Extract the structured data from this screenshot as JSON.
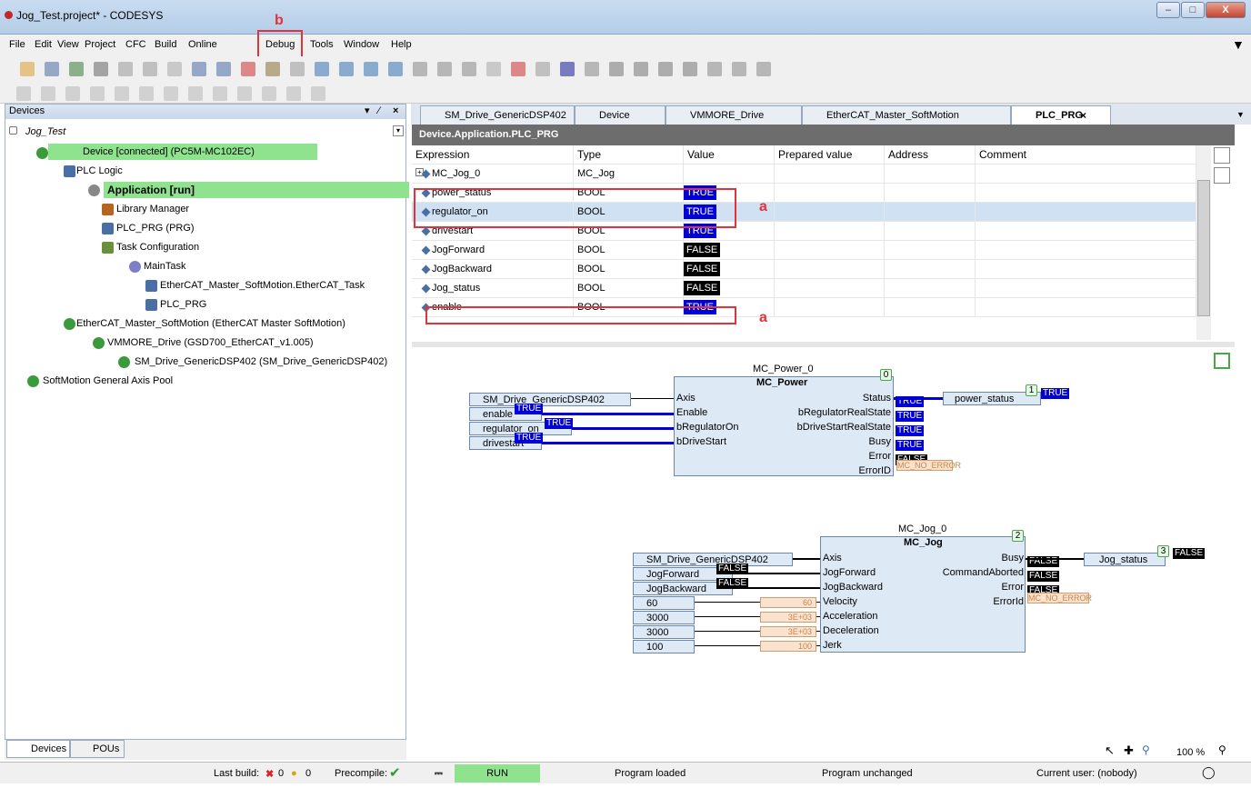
{
  "window": {
    "title": "Jog_Test.project* - CODESYS"
  },
  "menu": [
    "File",
    "Edit",
    "View",
    "Project",
    "CFC",
    "Build",
    "Online",
    "Debug",
    "Tools",
    "Window",
    "Help"
  ],
  "annotations": {
    "b": "b",
    "a": "a"
  },
  "devices": {
    "header": "Devices",
    "pin": "❑",
    "close": "×",
    "items": [
      {
        "label": "Jog_Test",
        "italic": true
      },
      {
        "label": "Device [connected] (PC5M-MC102EC)"
      },
      {
        "label": "PLC Logic"
      },
      {
        "label": "Application [run]"
      },
      {
        "label": "Library Manager"
      },
      {
        "label": "PLC_PRG (PRG)"
      },
      {
        "label": "Task Configuration"
      },
      {
        "label": "MainTask"
      },
      {
        "label": "EtherCAT_Master_SoftMotion.EtherCAT_Task"
      },
      {
        "label": "PLC_PRG"
      },
      {
        "label": "EtherCAT_Master_SoftMotion (EtherCAT Master SoftMotion)"
      },
      {
        "label": "VMMORE_Drive (GSD700_EtherCAT_v1.005)"
      },
      {
        "label": "SM_Drive_GenericDSP402 (SM_Drive_GenericDSP402)"
      },
      {
        "label": "SoftMotion General Axis Pool"
      }
    ]
  },
  "left_tabs": [
    "Devices",
    "POUs"
  ],
  "doc_tabs": [
    "SM_Drive_GenericDSP402",
    "Device",
    "VMMORE_Drive",
    "EtherCAT_Master_SoftMotion",
    "PLC_PRG"
  ],
  "editor": {
    "header": "Device.Application.PLC_PRG"
  },
  "table": {
    "columns": [
      "Expression",
      "Type",
      "Value",
      "Prepared value",
      "Address",
      "Comment"
    ],
    "rows": [
      {
        "expr": "MC_Jog_0",
        "type": "MC_Jog",
        "value": ""
      },
      {
        "expr": "power_status",
        "type": "BOOL",
        "value": "TRUE"
      },
      {
        "expr": "regulator_on",
        "type": "BOOL",
        "value": "TRUE"
      },
      {
        "expr": "drivestart",
        "type": "BOOL",
        "value": "TRUE"
      },
      {
        "expr": "JogForward",
        "type": "BOOL",
        "value": "FALSE"
      },
      {
        "expr": "JogBackward",
        "type": "BOOL",
        "value": "FALSE"
      },
      {
        "expr": "Jog_status",
        "type": "BOOL",
        "value": "FALSE"
      },
      {
        "expr": "enable",
        "type": "BOOL",
        "value": "TRUE"
      }
    ]
  },
  "cfc": {
    "power": {
      "instance": "MC_Power_0",
      "type": "MC_Power",
      "number": "0",
      "inputs": [
        "Axis",
        "Enable",
        "bRegulatorOn",
        "bDriveStart"
      ],
      "outputs": [
        "Status",
        "bRegulatorRealState",
        "bDriveStartRealState",
        "Busy",
        "Error",
        "ErrorID"
      ],
      "in_vars": [
        "SM_Drive_GenericDSP402",
        "enable",
        "regulator_on",
        "drivestart"
      ],
      "in_vals": [
        "",
        "TRUE",
        "TRUE",
        "TRUE"
      ],
      "out_vals": [
        "TRUE",
        "TRUE",
        "TRUE",
        "TRUE",
        "FALSE",
        "MC_NO_ERROR"
      ],
      "out_var": "power_status",
      "out_num": "1",
      "out_var_val": "TRUE"
    },
    "jog": {
      "instance": "MC_Jog_0",
      "type": "MC_Jog",
      "number": "2",
      "inputs": [
        "Axis",
        "JogForward",
        "JogBackward",
        "Velocity",
        "Acceleration",
        "Deceleration",
        "Jerk"
      ],
      "outputs": [
        "Busy",
        "CommandAborted",
        "Error",
        "ErrorId"
      ],
      "in_vars": [
        "SM_Drive_GenericDSP402",
        "JogForward",
        "JogBackward",
        "60",
        "3000",
        "3000",
        "100"
      ],
      "in_vals": [
        "",
        "FALSE",
        "FALSE",
        "60",
        "3E+03",
        "3E+03",
        "100"
      ],
      "out_vals": [
        "FALSE",
        "FALSE",
        "FALSE",
        "MC_NO_ERROR"
      ],
      "out_var": "Jog_status",
      "out_num": "3",
      "out_var_val": "FALSE"
    },
    "zoom": "100 %"
  },
  "status": {
    "last_build": "Last build:",
    "errors": "0",
    "warnings": "0",
    "precompile": "Precompile:",
    "run": "RUN",
    "program_loaded": "Program loaded",
    "program_unchanged": "Program unchanged",
    "current_user": "Current user: (nobody)"
  },
  "colors": {
    "true_bg": "#0000d6",
    "false_bg": "#000000",
    "online_green": "#8fe38f",
    "annot_red": "#e0333a"
  }
}
